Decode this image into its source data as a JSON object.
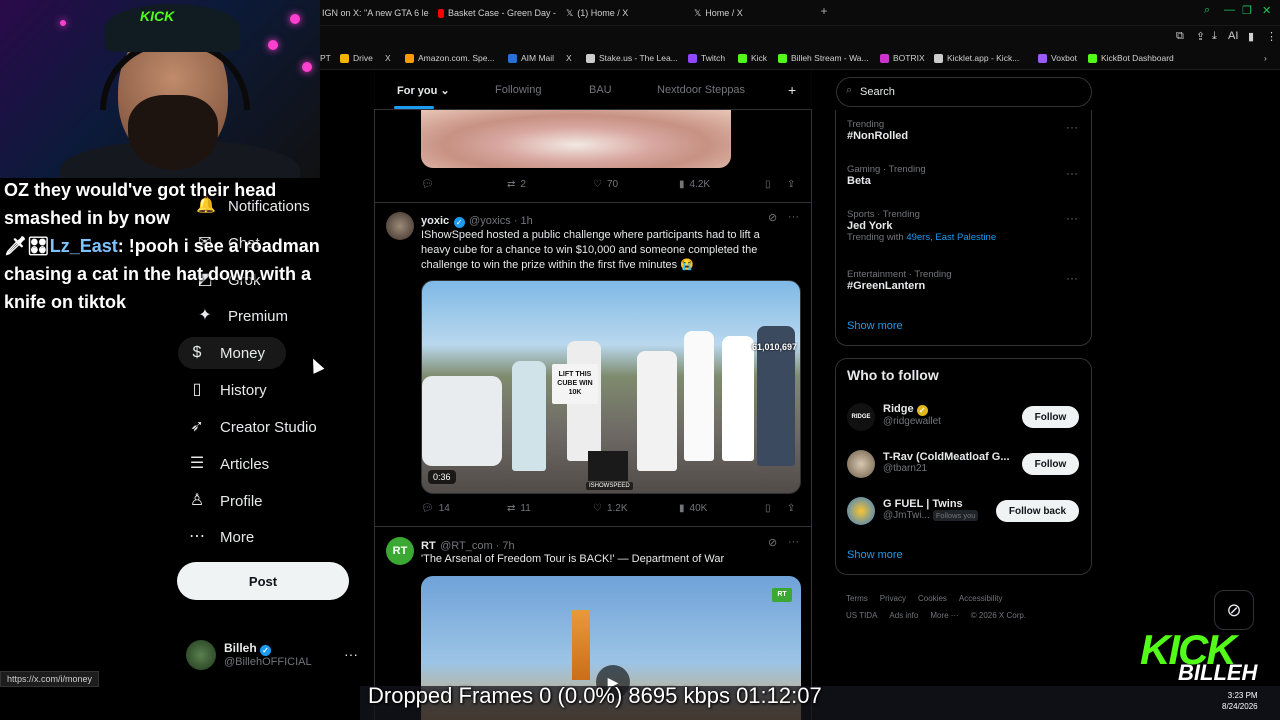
{
  "browser": {
    "tabs": [
      {
        "label": "IGN on X: \"A new GTA 6 le",
        "color": "#000000"
      },
      {
        "label": "Basket Case - Green Day -",
        "color": "#ff0000"
      },
      {
        "label": "(1) Home / X",
        "color": "#ffffff"
      },
      {
        "label": "Home / X",
        "color": "#ffffff"
      }
    ],
    "bookmarks": [
      {
        "label": "PT",
        "color": "#888888"
      },
      {
        "label": "Drive",
        "color": "#f4b400"
      },
      {
        "label": "X",
        "color": "#ffffff"
      },
      {
        "label": "Amazon.com. Spe...",
        "color": "#ff9900"
      },
      {
        "label": "AIM Mail",
        "color": "#2a6fd6"
      },
      {
        "label": "X",
        "color": "#ffffff"
      },
      {
        "label": "Stake.us - The Lea...",
        "color": "#cccccc"
      },
      {
        "label": "Twitch",
        "color": "#9146ff"
      },
      {
        "label": "Kick",
        "color": "#53fc18"
      },
      {
        "label": "Billeh Stream - Wa...",
        "color": "#53fc18"
      },
      {
        "label": "BOTRIX",
        "color": "#cc33cc"
      },
      {
        "label": "Kicklet.app - Kick...",
        "color": "#cccccc"
      },
      {
        "label": "Voxbot",
        "color": "#9b59ff"
      },
      {
        "label": "KickBot Dashboard",
        "color": "#53fc18"
      }
    ]
  },
  "stream": {
    "cap_logo": "KICK",
    "chat_line1": "OZ they would've got their head smashed in by now",
    "chat_user": "Lz_East",
    "chat_line2": ": !pooh i see a roadman chasing a cat in the hat down with a knife on tiktok",
    "stats": "Dropped Frames 0 (0.0%)   8695 kbps   01:12:07",
    "clock_time": "3:23 PM",
    "clock_date": "8/24/2026",
    "kick_logo": "KICK",
    "kick_sub": "BILLEH",
    "status_url": "https://x.com/i/money"
  },
  "nav": {
    "items": [
      {
        "label": "Notifications",
        "icon": "bell-icon",
        "glyph": "🔔"
      },
      {
        "label": "Chat",
        "icon": "chat-icon",
        "glyph": "✉"
      },
      {
        "label": "Grok",
        "icon": "grok-icon",
        "glyph": "◩"
      },
      {
        "label": "Premium",
        "icon": "premium-icon",
        "glyph": "✦"
      },
      {
        "label": "Money",
        "icon": "money-icon",
        "glyph": "$"
      },
      {
        "label": "History",
        "icon": "bookmark-icon",
        "glyph": "▯"
      },
      {
        "label": "Creator Studio",
        "icon": "rocket-icon",
        "glyph": "➶"
      },
      {
        "label": "Articles",
        "icon": "articles-icon",
        "glyph": "☰"
      },
      {
        "label": "Profile",
        "icon": "profile-icon",
        "glyph": "♙"
      },
      {
        "label": "More",
        "icon": "more-icon",
        "glyph": "⋯"
      }
    ],
    "post_label": "Post",
    "account_name": "Billeh",
    "account_handle": "@BillehOFFICIAL"
  },
  "timeline": {
    "tabs": [
      "For you",
      "Following",
      "BAU",
      "Nextdoor Steppas"
    ],
    "tweet1": {
      "replies": "",
      "reposts": "2",
      "likes": "70",
      "views": "4.2K"
    },
    "tweet2": {
      "name": "yoxic",
      "handle": "@yoxics · 1h",
      "text": "IShowSpeed hosted a public challenge where participants had to lift a heavy cube for a chance to win $10,000 and someone completed the challenge to win the prize within the first five minutes 😭",
      "sign": "LIFT THIS CUBE WIN 10K",
      "overlay_count": "61,010,697",
      "video_time": "0:36",
      "video_brand": "ISHOWSPEED",
      "replies": "14",
      "reposts": "11",
      "likes": "1.2K",
      "views": "40K"
    },
    "tweet3": {
      "avatar": "RT",
      "name": "RT",
      "handle": "@RT_com · 7h",
      "text": "'The Arsenal of Freedom Tour is BACK!' — Department of War",
      "badge": "RT"
    }
  },
  "sidebar": {
    "search_placeholder": "Search",
    "trends": [
      {
        "category": "Trending",
        "name": "#NonRolled",
        "with": "",
        "with_links": ""
      },
      {
        "category": "Gaming · Trending",
        "name": "Beta",
        "with": "",
        "with_links": ""
      },
      {
        "category": "Sports · Trending",
        "name": "Jed York",
        "with": "Trending with",
        "with_links": "49ers, East Palestine"
      },
      {
        "category": "Entertainment · Trending",
        "name": "#GreenLantern",
        "with": "",
        "with_links": ""
      }
    ],
    "show_more": "Show more",
    "who_to_follow_title": "Who to follow",
    "who_to_follow": [
      {
        "name": "Ridge",
        "handle": "@ridgewallet",
        "button": "Follow",
        "follows_you": "",
        "avatar_text": "RIDGE"
      },
      {
        "name": "T-Rav (ColdMeatloaf G...",
        "handle": "@tbarn21",
        "button": "Follow",
        "follows_you": "",
        "avatar_text": ""
      },
      {
        "name": "G FUEL | Twins",
        "handle": "@JmTwi...",
        "button": "Follow back",
        "follows_you": "Follows you",
        "avatar_text": ""
      }
    ],
    "footer": [
      "Terms",
      "Privacy",
      "Cookies",
      "Accessibility",
      "US TIDA",
      "Ads info",
      "More ···",
      "© 2026 X Corp."
    ]
  }
}
